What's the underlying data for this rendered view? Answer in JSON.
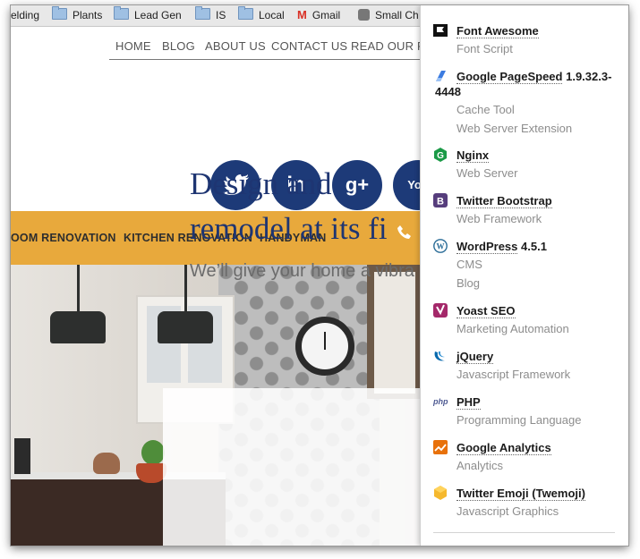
{
  "bookmarks": [
    {
      "label": "elding",
      "icon": "none"
    },
    {
      "label": "Plants",
      "icon": "folder-icon"
    },
    {
      "label": "Lead Gen",
      "icon": "folder-icon"
    },
    {
      "label": "IS",
      "icon": "folder-icon"
    },
    {
      "label": "Local",
      "icon": "folder-icon"
    },
    {
      "label": "Gmail",
      "icon": "gmail-icon"
    },
    {
      "label": "Small Ch",
      "icon": "apple-icon"
    }
  ],
  "site": {
    "nav": [
      "HOME",
      "BLOG",
      "ABOUT US",
      "CONTACT US",
      "READ OUR RE"
    ],
    "social": [
      {
        "name": "twitter",
        "glyph": "t"
      },
      {
        "name": "linkedin",
        "glyph": "in"
      },
      {
        "name": "google-plus",
        "glyph": "g+"
      },
      {
        "name": "youtube",
        "glyph": "You"
      }
    ],
    "services": [
      "OOM RENOVATION",
      "KITCHEN RENOVATION",
      "HANDYMAN"
    ],
    "hero_title": "Design and\nremodel at its fi",
    "hero_sub": "We’ll give your home a vibra"
  },
  "wappalyzer": {
    "entries": [
      {
        "name": "Font Awesome",
        "version": "",
        "icon": "font-awesome-icon",
        "categories": [
          "Font Script"
        ]
      },
      {
        "name": "Google PageSpeed",
        "version": "1.9.32.3-4448",
        "icon": "google-pagespeed-icon",
        "categories": [
          "Cache Tool",
          "Web Server Extension"
        ]
      },
      {
        "name": "Nginx",
        "version": "",
        "icon": "nginx-icon",
        "categories": [
          "Web Server"
        ]
      },
      {
        "name": "Twitter Bootstrap",
        "version": "",
        "icon": "bootstrap-icon",
        "categories": [
          "Web Framework"
        ]
      },
      {
        "name": "WordPress",
        "version": "4.5.1",
        "icon": "wordpress-icon",
        "categories": [
          "CMS",
          "Blog"
        ]
      },
      {
        "name": "Yoast SEO",
        "version": "",
        "icon": "yoast-icon",
        "categories": [
          "Marketing Automation"
        ]
      },
      {
        "name": "jQuery",
        "version": "",
        "icon": "jquery-icon",
        "categories": [
          "Javascript Framework"
        ]
      },
      {
        "name": "PHP",
        "version": "",
        "icon": "php-icon",
        "categories": [
          "Programming Language"
        ]
      },
      {
        "name": "Google Analytics",
        "version": "",
        "icon": "google-analytics-icon",
        "categories": [
          "Analytics"
        ]
      },
      {
        "name": "Twitter Emoji (Twemoji)",
        "version": "",
        "icon": "twemoji-icon",
        "categories": [
          "Javascript Graphics"
        ]
      }
    ]
  },
  "colors": {
    "brand_navy": "#1d3a78",
    "band": "#e8a93c",
    "link_text": "#1b1b1b",
    "category_text": "#8d8d8d"
  }
}
